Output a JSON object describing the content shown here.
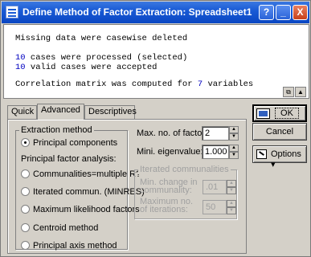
{
  "window": {
    "title": "Define Method of Factor Extraction: Spreadsheet1",
    "help_btn": "?",
    "min_btn": "_",
    "close_btn": "X"
  },
  "output": {
    "line1": "Missing data were casewise deleted",
    "line2_num": "10",
    "line2_text": " cases were processed (selected)",
    "line3_num": "10",
    "line3_text": " valid cases were accepted",
    "line4_text": "Correlation matrix was computed for ",
    "line4_num": "7",
    "line4_end": " variables"
  },
  "tabs": [
    "Quick",
    "Advanced",
    "Descriptives"
  ],
  "extraction": {
    "group_title": "Extraction method",
    "principal_components": "Principal components",
    "pfa_label": "Principal factor analysis:",
    "communalities": "Communalities=multiple R?",
    "iterated": "Iterated commun. (MINRES)",
    "max_likelihood": "Maximum likelihood factors",
    "centroid": "Centroid method",
    "principal_axis": "Principal axis method"
  },
  "params": {
    "max_factors_label": "Max. no. of factors:",
    "max_factors_value": "2",
    "min_eigen_label": "Mini. eigenvalue:",
    "min_eigen_value": "1.000",
    "iter_group_title": "Iterated communalities",
    "min_change_label_1": "Min. change in",
    "min_change_label_2": "communality:",
    "min_change_value": ".01",
    "max_iter_label_1": "Maximum no.",
    "max_iter_label_2": "of iterations:",
    "max_iter_value": "50"
  },
  "buttons": {
    "ok": "OK",
    "cancel": "Cancel",
    "options": "Options ▾"
  }
}
